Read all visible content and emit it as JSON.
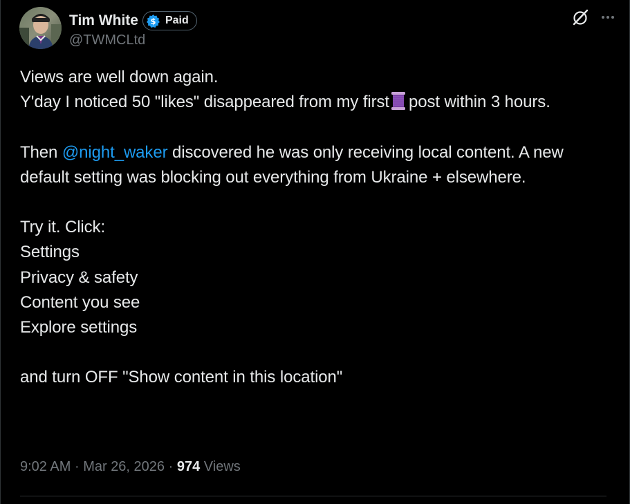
{
  "author": {
    "display_name": "Tim White",
    "badge_label": "Paid",
    "handle": "@TWMCLtd"
  },
  "icons": {
    "badge": "dollar-sign-icon",
    "grok": "grok-icon",
    "more": "more-horizontal-icon",
    "thread_emoji": "spool-of-thread-icon"
  },
  "tweet": {
    "line1": "Views are well down again.",
    "line2_before": "Y'day I noticed 50 \"likes\" disappeared from my first",
    "line2_after": "post within 3 hours.",
    "para2_before": "Then",
    "mention": "@night_waker",
    "para2_after": "discovered he was only receiving local content. A new default setting was blocking out everything from Ukraine + elsewhere.",
    "steps_intro": "Try it. Click:",
    "steps": [
      "Settings",
      "Privacy & safety",
      "Content you see",
      "Explore settings"
    ],
    "closing": "and turn OFF \"Show content in this location\""
  },
  "meta": {
    "time": "9:02 AM",
    "separator": "·",
    "date": "Mar 26, 2026",
    "views_count": "974",
    "views_label": "Views"
  },
  "colors": {
    "background": "#000000",
    "text": "#e7e9ea",
    "secondary": "#71767b",
    "link": "#1d9bf0",
    "badge_blue": "#1d9bf0",
    "divider": "#2f3336"
  }
}
